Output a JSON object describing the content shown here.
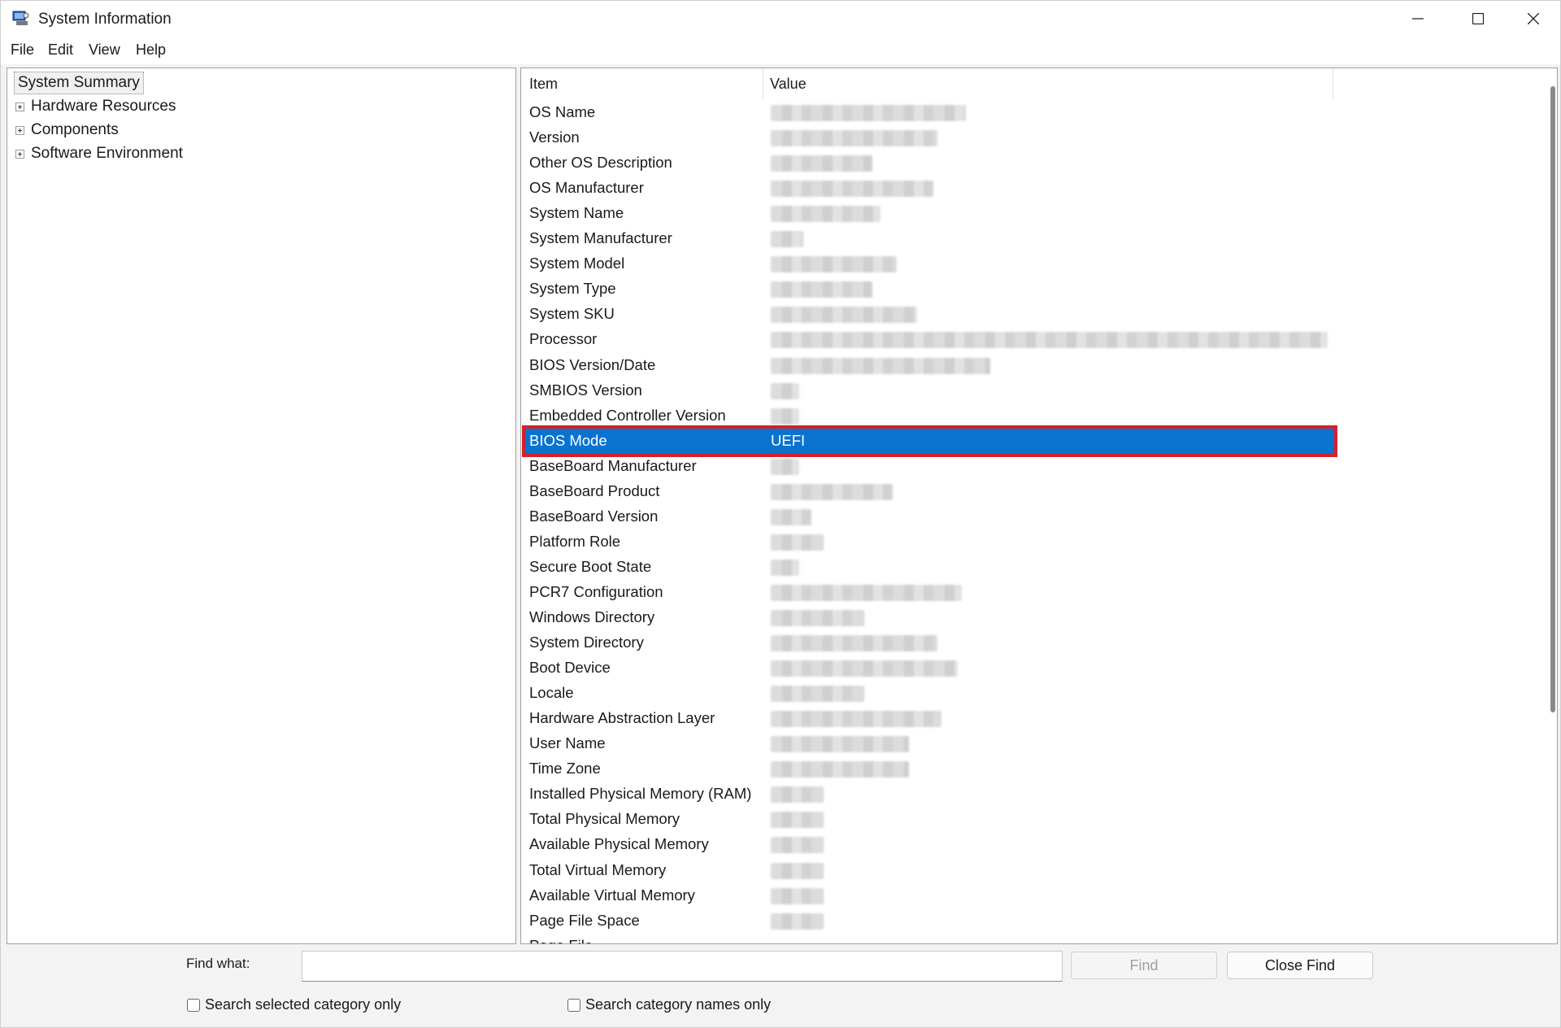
{
  "window": {
    "title": "System Information"
  },
  "menu": [
    "File",
    "Edit",
    "View",
    "Help"
  ],
  "tree": {
    "root": "System Summary",
    "nodes": [
      "Hardware Resources",
      "Components",
      "Software Environment"
    ]
  },
  "table": {
    "columns": [
      "Item",
      "Value"
    ],
    "rows": [
      {
        "item": "OS Name",
        "value": null
      },
      {
        "item": "Version",
        "value": null
      },
      {
        "item": "Other OS Description",
        "value": null
      },
      {
        "item": "OS Manufacturer",
        "value": null
      },
      {
        "item": "System Name",
        "value": null
      },
      {
        "item": "System Manufacturer",
        "value": null
      },
      {
        "item": "System Model",
        "value": null
      },
      {
        "item": "System Type",
        "value": null
      },
      {
        "item": "System SKU",
        "value": null
      },
      {
        "item": "Processor",
        "value": null
      },
      {
        "item": "BIOS Version/Date",
        "value": null
      },
      {
        "item": "SMBIOS Version",
        "value": null
      },
      {
        "item": "Embedded Controller Version",
        "value": null
      },
      {
        "item": "BIOS Mode",
        "value": "UEFI",
        "selected": true
      },
      {
        "item": "BaseBoard Manufacturer",
        "value": null
      },
      {
        "item": "BaseBoard Product",
        "value": null
      },
      {
        "item": "BaseBoard Version",
        "value": null
      },
      {
        "item": "Platform Role",
        "value": null
      },
      {
        "item": "Secure Boot State",
        "value": null
      },
      {
        "item": "PCR7 Configuration",
        "value": null
      },
      {
        "item": "Windows Directory",
        "value": null
      },
      {
        "item": "System Directory",
        "value": null
      },
      {
        "item": "Boot Device",
        "value": null
      },
      {
        "item": "Locale",
        "value": null
      },
      {
        "item": "Hardware Abstraction Layer",
        "value": null
      },
      {
        "item": "User Name",
        "value": null
      },
      {
        "item": "Time Zone",
        "value": null
      },
      {
        "item": "Installed Physical Memory (RAM)",
        "value": null
      },
      {
        "item": "Total Physical Memory",
        "value": null
      },
      {
        "item": "Available Physical Memory",
        "value": null
      },
      {
        "item": "Total Virtual Memory",
        "value": null
      },
      {
        "item": "Available Virtual Memory",
        "value": null
      },
      {
        "item": "Page File Space",
        "value": null
      },
      {
        "item": "Page File",
        "value": null
      }
    ]
  },
  "find": {
    "label": "Find what:",
    "value": "",
    "find_button": "Find",
    "close_button": "Close Find",
    "chk_selected": "Search selected category only",
    "chk_names": "Search category names only"
  },
  "colors": {
    "selection": "#0a73d0",
    "highlight_box": "#d61f2c"
  }
}
